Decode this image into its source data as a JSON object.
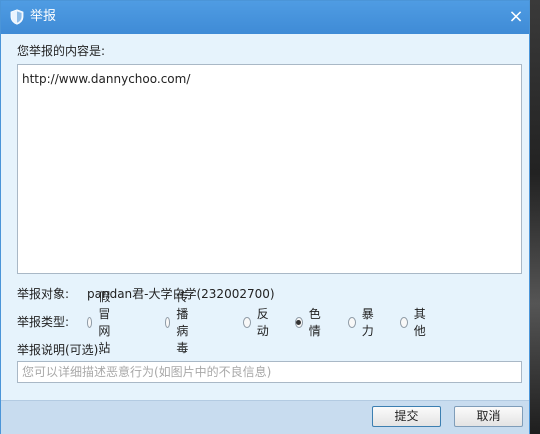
{
  "window": {
    "title": "举报",
    "close_glyph": "×"
  },
  "content": {
    "label": "您举报的内容是:",
    "value": "http://www.dannychoo.com/"
  },
  "target": {
    "label": "举报对象:",
    "value": "pandan君-大学白学(232002700)"
  },
  "type": {
    "label": "举报类型:",
    "options": [
      "假冒网站",
      "传播病毒",
      "反动",
      "色情",
      "暴力",
      "其他"
    ],
    "selected": "色情"
  },
  "description": {
    "label": "举报说明(可选):",
    "value": "",
    "placeholder": "您可以详细描述恶意行为(如图片中的不良信息)"
  },
  "buttons": {
    "submit": "提交",
    "cancel": "取消"
  },
  "colors": {
    "titlebar": "#4a97df",
    "body": "#e6f3fc",
    "footer": "#c8dcef"
  }
}
